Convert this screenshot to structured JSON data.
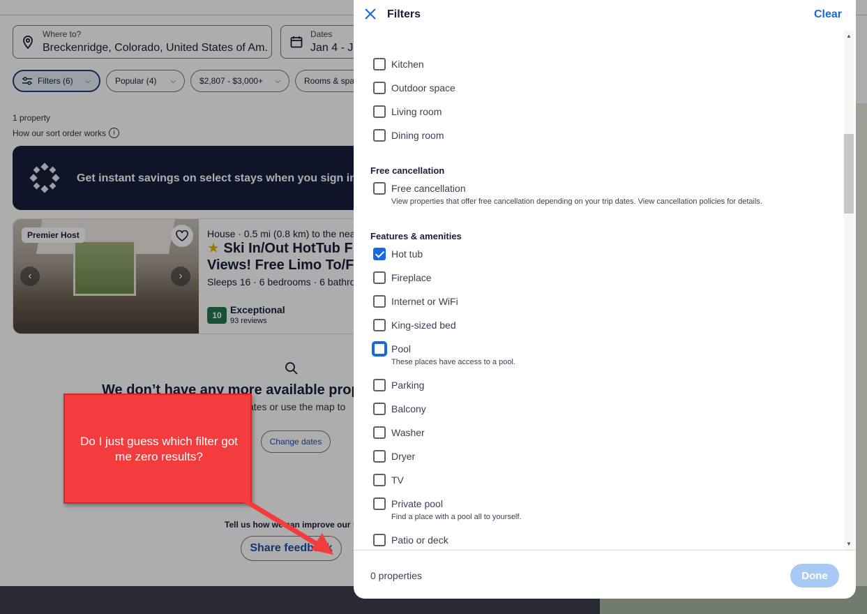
{
  "search": {
    "where_label": "Where to?",
    "where_value": "Breckenridge, Colorado, United States of Am...",
    "dates_label": "Dates",
    "dates_value": "Jan 4 - Ja"
  },
  "pills": [
    "Filters (6)",
    "Popular (4)",
    "$2,807 - $3,000+",
    "Rooms & spac"
  ],
  "results": {
    "count": "1 property",
    "sort_note": "How our sort order works"
  },
  "banner": {
    "text": "Get instant savings on select stays when you sign in"
  },
  "listing": {
    "badge": "Premier Host",
    "meta": "House · 0.5 mi (0.8 km) to the neare",
    "title": "Ski In/Out HotTub F Views! Free Limo To/Fr",
    "sleeps": "Sleeps 16 · 6 bedrooms · 6 bathroo",
    "score": "10",
    "rating_label": "Exceptional",
    "reviews": "93 reviews"
  },
  "empty_state": {
    "headline": "We don’t have any more available propo",
    "sub": "ates or use the map to",
    "change_dates": "Change dates",
    "tell_us": "Tell us how we can improve our sit",
    "share_feedback": "Share feedback"
  },
  "filters_panel": {
    "title": "Filters",
    "clear": "Clear",
    "options_top": [
      {
        "label": "Kitchen",
        "checked": false
      },
      {
        "label": "Outdoor space",
        "checked": false
      },
      {
        "label": "Living room",
        "checked": false
      },
      {
        "label": "Dining room",
        "checked": false
      }
    ],
    "free_cancellation": {
      "heading": "Free cancellation",
      "label": "Free cancellation",
      "description": "View properties that offer free cancellation depending on your trip dates. View cancellation policies for details."
    },
    "features": {
      "heading": "Features & amenities",
      "options": [
        {
          "label": "Hot tub",
          "checked": true
        },
        {
          "label": "Fireplace",
          "checked": false
        },
        {
          "label": "Internet or WiFi",
          "checked": false
        },
        {
          "label": "King-sized bed",
          "checked": false
        },
        {
          "label": "Pool",
          "checked": false,
          "description": "These places have access to a pool."
        },
        {
          "label": "Parking",
          "checked": false
        },
        {
          "label": "Balcony",
          "checked": false
        },
        {
          "label": "Washer",
          "checked": false
        },
        {
          "label": "Dryer",
          "checked": false
        },
        {
          "label": "TV",
          "checked": false
        },
        {
          "label": "Private pool",
          "checked": false,
          "description": "Find a place with a pool all to yourself."
        },
        {
          "label": "Patio or deck",
          "checked": false
        }
      ]
    },
    "footer_count": "0 properties",
    "done": "Done"
  },
  "annotation": {
    "text": "Do I just guess which filter got me zero results?",
    "color": "#f33c3e"
  }
}
